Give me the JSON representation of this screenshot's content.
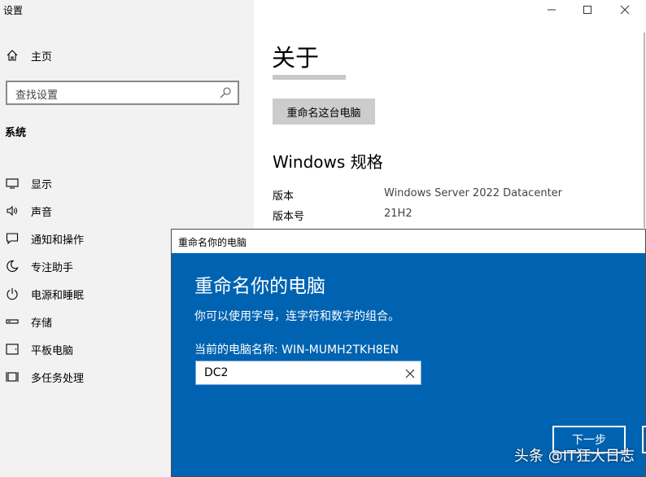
{
  "window": {
    "title": "设置"
  },
  "sidebar": {
    "home_label": "主页",
    "search_placeholder": "查找设置",
    "section_title": "系统",
    "items": [
      {
        "label": "显示",
        "icon": "display-icon"
      },
      {
        "label": "声音",
        "icon": "sound-icon"
      },
      {
        "label": "通知和操作",
        "icon": "notification-icon"
      },
      {
        "label": "专注助手",
        "icon": "moon-icon"
      },
      {
        "label": "电源和睡眠",
        "icon": "power-icon"
      },
      {
        "label": "存储",
        "icon": "storage-icon"
      },
      {
        "label": "平板电脑",
        "icon": "tablet-icon"
      },
      {
        "label": "多任务处理",
        "icon": "multitask-icon"
      }
    ]
  },
  "main": {
    "page_title": "关于",
    "rename_button": "重命名这台电脑",
    "spec_title": "Windows 规格",
    "specs": [
      {
        "key": "版本",
        "value": "Windows Server 2022 Datacenter"
      },
      {
        "key": "版本号",
        "value": "21H2"
      }
    ]
  },
  "dialog": {
    "title": "重命名你的电脑",
    "heading": "重命名你的电脑",
    "description": "你可以使用字母，连字符和数字的组合。",
    "current_name": "当前的电脑名称: WIN-MUMH2TKH8EN",
    "input_value": "DC2",
    "next_button": "下一步"
  },
  "watermark": "头条 @IT狂大日志",
  "colors": {
    "sidebar_bg": "#f2f2f2",
    "dialog_blue": "#0063b1",
    "button_gray": "#cccccc"
  }
}
